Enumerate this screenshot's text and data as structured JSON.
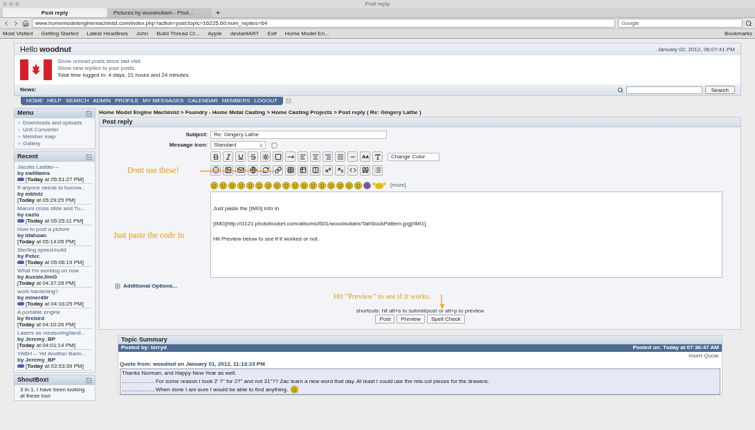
{
  "window": {
    "title": "Post reply"
  },
  "browser": {
    "tabs": [
      {
        "label": "Post reply",
        "selected": true
      },
      {
        "label": "Pictures by woodnutiam - Phot...",
        "selected": false
      }
    ],
    "url": "www.homemodelenginemachinist.com/index.php?action=post;topic=16225.60;num_replies=64",
    "new_tab": "+",
    "search_placeholder": "Google",
    "bookmarks": [
      "Most Visited",
      "Getting Started",
      "Latest Headlines",
      "John",
      "Build Thread Cr...",
      "Apple",
      "deviantART",
      "Exif",
      "Home Model En..."
    ],
    "bookmarks_menu": "Bookmarks"
  },
  "header": {
    "greeting": "Hello **woodnut**",
    "date": "January 02, 2012, 06:07:41 PM",
    "links": [
      "Show unread posts since last visit.",
      "Show new replies to your posts."
    ],
    "time_logged": "Total time logged in: 4 days, 21 hours and 24 minutes.",
    "news_label": "News:",
    "search_button": "Search"
  },
  "nav": [
    "HOME",
    "HELP",
    "SEARCH",
    "ADMIN",
    "PROFILE",
    "MY MESSAGES",
    "CALENDAR",
    "MEMBERS",
    "LOGOUT"
  ],
  "sidebar": {
    "menu": {
      "title": "Menu",
      "items": [
        "Downloads and uploads",
        "Unit Converter",
        "Member map",
        "Gallery"
      ]
    },
    "recent": {
      "title": "Recent",
      "items": [
        {
          "topic": "Jacobs Ladder---",
          "author": "by ewilliams",
          "new": true,
          "time": "[**Today** at 05:51:27 PM]"
        },
        {
          "topic": "If anyone needs to borrow...",
          "author": "by mklotz",
          "new": false,
          "time": "[**Today** at 05:29:25 PM]"
        },
        {
          "topic": "Maroni cross slide and Tu...",
          "author": "by cazlo",
          "new": true,
          "time": "[**Today** at 05:25:11 PM]"
        },
        {
          "topic": "How to post a picture",
          "author": "by Idahoan",
          "new": false,
          "time": "[**Today** at 05:14:05 PM]"
        },
        {
          "topic": "Sterling speed-build",
          "author": "by Peter.",
          "new": true,
          "time": "[**Today** at 05:06:19 PM]"
        },
        {
          "topic": "What I'm working on now",
          "author": "by AussieJimG",
          "new": false,
          "time": "[**Today** at 04:37:28 PM]"
        },
        {
          "topic": "work hardening?",
          "author": "by miner49r",
          "new": true,
          "time": "[**Today** at 04:16:25 PM]"
        },
        {
          "topic": "A portable engine",
          "author": "by firebird",
          "new": false,
          "time": "[**Today** at 04:10:26 PM]"
        },
        {
          "topic": "Lasers as measuring/land...",
          "author": "by Jeremy_BP",
          "new": false,
          "time": "[**Today** at 04:01:14 PM]"
        },
        {
          "topic": "YABH -- Yet Another Barin...",
          "author": "by Jeremy_BP",
          "new": true,
          "time": "[**Today** at 03:53:39 PM]"
        }
      ]
    },
    "shoutbox": {
      "title": "ShoutBox!",
      "text": "3 in 1, I have been looking at these too!"
    }
  },
  "breadcrumb": "Home Model Engine Machinist > Foundry - Home Metal Casting > Home Casting Projects > Post reply ( Re: Gingery Lathe )",
  "form": {
    "title": "Post reply",
    "subject_label": "Subject:",
    "subject": "Re: Gingery Lathe",
    "icon_label": "Message icon:",
    "icon_value": "Standard",
    "color_select": "Change Color",
    "more_link": "[more]",
    "message": "Just paste the [IMG] info in\n\n[IMG]http://i1121.photobucket.com/albums/l501/woodnutiam/TailStockPattern.jpg[/IMG]\n\nHit Preview below to see if it worked or not.",
    "additional_options": "Additional Options...",
    "shortcuts": "shortcuts: hit alt+s to submit/post or alt+p to preview",
    "buttons": [
      "Post",
      "Preview",
      "Spell Check"
    ]
  },
  "annotations": {
    "toolbar": "Dont use these!",
    "message": "Just paste the code in",
    "preview": "Hit \"Preview\" to see if it works."
  },
  "summary": {
    "title": "Topic Summary",
    "posted_by": "Posted by: terryd",
    "posted_on": "Posted on: Today at 07:36:47 AM",
    "insert_quote": "Insert Quote",
    "quote_from": "Quote from: woodnut on January 01, 2012, 11:13:23 PM",
    "lines": [
      "Thanks Norman, and Happy New Year as well.",
      "..................... For some reason I took 2' 7\" for 27\" and not 31\"?? Zac learn a new word that day. At least I could use the mis-cut pieces for the drawers.",
      "..................... When done I am sure I would be able to find anything."
    ]
  }
}
